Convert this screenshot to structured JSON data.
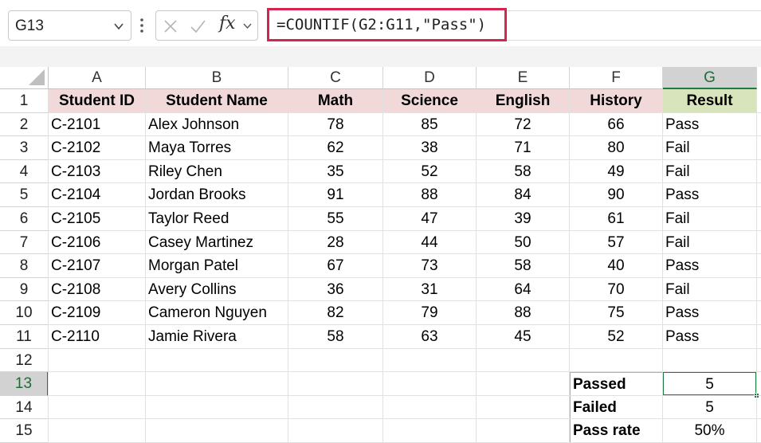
{
  "name_box": {
    "value": "G13"
  },
  "formula_bar": {
    "formula": "=COUNTIF(G2:G11,\"Pass\")",
    "fx_label": "fx"
  },
  "columns": [
    "A",
    "B",
    "C",
    "D",
    "E",
    "F",
    "G"
  ],
  "selected_column": "G",
  "rows": [
    "1",
    "2",
    "3",
    "4",
    "5",
    "6",
    "7",
    "8",
    "9",
    "10",
    "11",
    "12",
    "13",
    "14",
    "15"
  ],
  "selected_row": "13",
  "table": {
    "headers": [
      "Student ID",
      "Student Name",
      "Math",
      "Science",
      "English",
      "History",
      "Result"
    ],
    "records": [
      [
        "C-2101",
        "Alex Johnson",
        "78",
        "85",
        "72",
        "66",
        "Pass"
      ],
      [
        "C-2102",
        "Maya Torres",
        "62",
        "38",
        "71",
        "80",
        "Fail"
      ],
      [
        "C-2103",
        "Riley Chen",
        "35",
        "52",
        "58",
        "49",
        "Fail"
      ],
      [
        "C-2104",
        "Jordan Brooks",
        "91",
        "88",
        "84",
        "90",
        "Pass"
      ],
      [
        "C-2105",
        "Taylor Reed",
        "55",
        "47",
        "39",
        "61",
        "Fail"
      ],
      [
        "C-2106",
        "Casey Martinez",
        "28",
        "44",
        "50",
        "57",
        "Fail"
      ],
      [
        "C-2107",
        "Morgan Patel",
        "67",
        "73",
        "58",
        "40",
        "Pass"
      ],
      [
        "C-2108",
        "Avery Collins",
        "36",
        "31",
        "64",
        "70",
        "Fail"
      ],
      [
        "C-2109",
        "Cameron Nguyen",
        "82",
        "79",
        "88",
        "75",
        "Pass"
      ],
      [
        "C-2110",
        "Jamie Rivera",
        "58",
        "63",
        "45",
        "52",
        "Pass"
      ]
    ]
  },
  "summary": [
    {
      "label": "Passed",
      "value": "5"
    },
    {
      "label": "Failed",
      "value": "5"
    },
    {
      "label": "Pass rate",
      "value": "50%"
    }
  ],
  "colors": {
    "header_fill": "#f2d9d9",
    "result_header_fill": "#d8e4bc",
    "formula_highlight": "#d6244f",
    "selection": "#1e7a44"
  }
}
